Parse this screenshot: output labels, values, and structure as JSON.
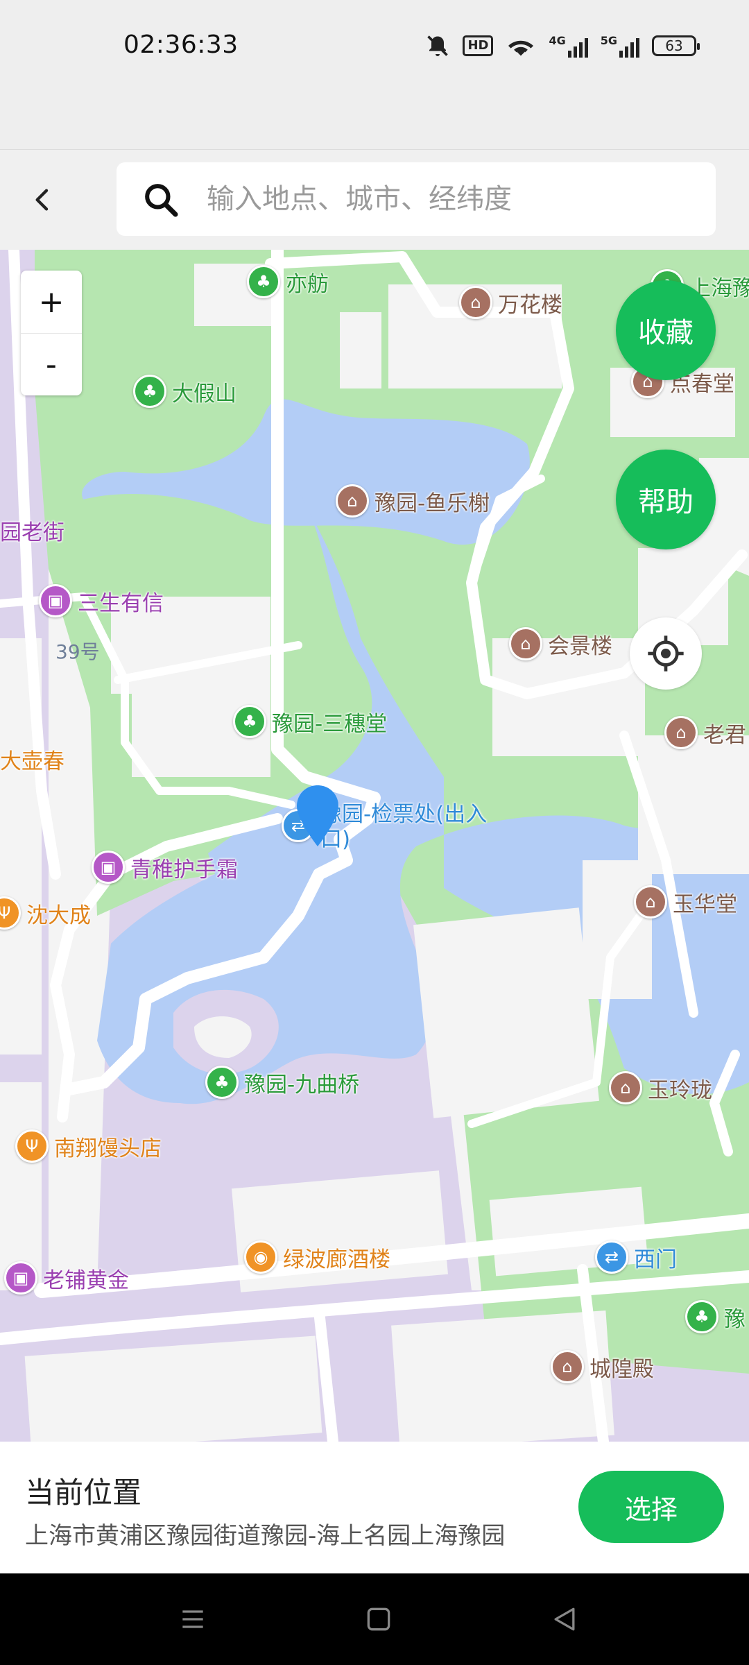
{
  "status_bar": {
    "time": "02:36:33",
    "battery": "63",
    "hd_label": "HD",
    "net_4g": "4G",
    "net_5g": "5G"
  },
  "header": {
    "search_placeholder": "输入地点、城市、经纬度"
  },
  "map": {
    "zoom_in": "+",
    "zoom_out": "-",
    "favorite_label": "收藏",
    "help_label": "帮助",
    "street_number": "39号",
    "pois": [
      {
        "name": "亦舫",
        "kind": "green"
      },
      {
        "name": "万花楼",
        "kind": "brown"
      },
      {
        "name": "上海豫",
        "kind": "green"
      },
      {
        "name": "点春堂",
        "kind": "brown"
      },
      {
        "name": "大假山",
        "kind": "green"
      },
      {
        "name": "豫园-鱼乐榭",
        "kind": "brown"
      },
      {
        "name": "园老街",
        "kind": "purple"
      },
      {
        "name": "三生有信",
        "kind": "purple"
      },
      {
        "name": "会景楼",
        "kind": "brown"
      },
      {
        "name": "豫园-三穗堂",
        "kind": "green"
      },
      {
        "name": "老君",
        "kind": "brown"
      },
      {
        "name": "大壶春",
        "kind": "orange"
      },
      {
        "name": "豫园-检票处(出入口)",
        "kind": "blue"
      },
      {
        "name": "青稚护手霜",
        "kind": "purple"
      },
      {
        "name": "玉华堂",
        "kind": "brown"
      },
      {
        "name": "沈大成",
        "kind": "orange"
      },
      {
        "name": "豫园-九曲桥",
        "kind": "green"
      },
      {
        "name": "玉玲珑",
        "kind": "brown"
      },
      {
        "name": "南翔馒头店",
        "kind": "orange"
      },
      {
        "name": "绿波廊酒楼",
        "kind": "orange"
      },
      {
        "name": "西门",
        "kind": "blue"
      },
      {
        "name": "老铺黄金",
        "kind": "purple"
      },
      {
        "name": "豫",
        "kind": "green"
      },
      {
        "name": "城隍殿",
        "kind": "brown"
      }
    ]
  },
  "bottom": {
    "title": "当前位置",
    "address": "上海市黄浦区豫园街道豫园-海上名园上海豫园",
    "select_label": "选择"
  },
  "colors": {
    "accent": "#16bd5a",
    "water": "#b3cdf6",
    "park": "#b6e6b0",
    "road": "#ffffff",
    "commercial": "#dcd3ec"
  }
}
